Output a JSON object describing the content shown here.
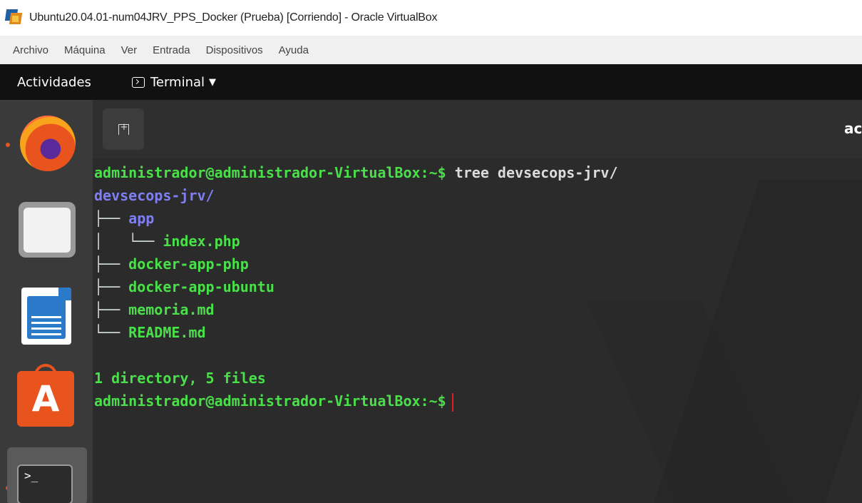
{
  "window": {
    "title": "Ubuntu20.04.01-num04JRV_PPS_Docker (Prueba) [Corriendo] - Oracle VirtualBox"
  },
  "menubar": {
    "items": [
      "Archivo",
      "Máquina",
      "Ver",
      "Entrada",
      "Dispositivos",
      "Ayuda"
    ]
  },
  "topbar": {
    "activities": "Actividades",
    "app_menu": "Terminal",
    "app_menu_caret": "▼"
  },
  "dock": {
    "items": [
      "firefox-icon",
      "files-icon",
      "libreoffice-writer-icon",
      "ubuntu-software-icon",
      "terminal-icon"
    ],
    "terminal_glyph": ">_"
  },
  "terminal": {
    "header_title": "ac",
    "prompt": "administrador@administrador-VirtualBox:~$",
    "command": " tree devsecops-jrv/",
    "tree": {
      "root": "devsecops-jrv/",
      "entries": [
        {
          "prefix": "├── ",
          "name": "app",
          "type": "dir"
        },
        {
          "prefix": "│   └── ",
          "name": "index.php",
          "type": "file"
        },
        {
          "prefix": "├── ",
          "name": "docker-app-php",
          "type": "file"
        },
        {
          "prefix": "├── ",
          "name": "docker-app-ubuntu",
          "type": "file"
        },
        {
          "prefix": "├── ",
          "name": "memoria.md",
          "type": "file"
        },
        {
          "prefix": "└── ",
          "name": "README.md",
          "type": "file"
        }
      ]
    },
    "summary": "1 directory, 5 files",
    "final_prompt": "administrador@administrador-VirtualBox:~$"
  },
  "colors": {
    "prompt_green": "#4ae04a",
    "dir_blue": "#7f7ff2",
    "cursor_red": "#e02020",
    "terminal_bg": "#2b2b2b",
    "topbar_bg": "#111111"
  }
}
